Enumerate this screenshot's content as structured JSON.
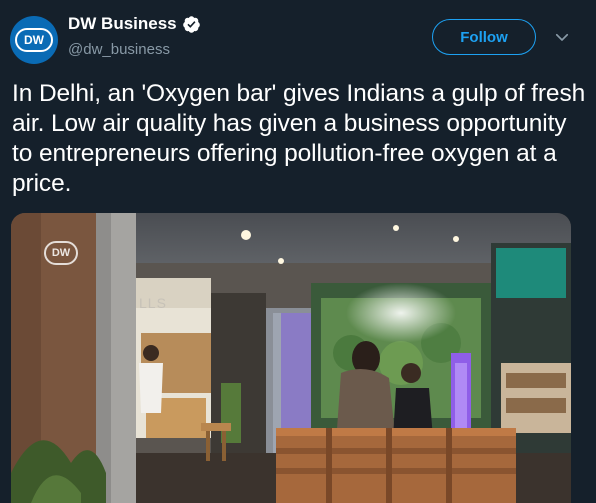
{
  "user": {
    "avatar_text": "DW",
    "name": "DW Business",
    "handle": "@dw_business",
    "verified": true
  },
  "actions": {
    "follow_label": "Follow",
    "menu_icon": "chevron-down-icon"
  },
  "tweet": {
    "text": "In Delhi, an 'Oxygen bar' gives Indians a gulp of fresh air. Low air quality has given a business opportunity to entrepreneurs offering pollution-free oxygen at a price."
  },
  "media": {
    "watermark": "DW",
    "sign_text": "LLS"
  },
  "colors": {
    "background": "#15202b",
    "accent": "#1da1f2",
    "secondary_text": "#8899a6",
    "verified_badge": "#ffffff"
  }
}
